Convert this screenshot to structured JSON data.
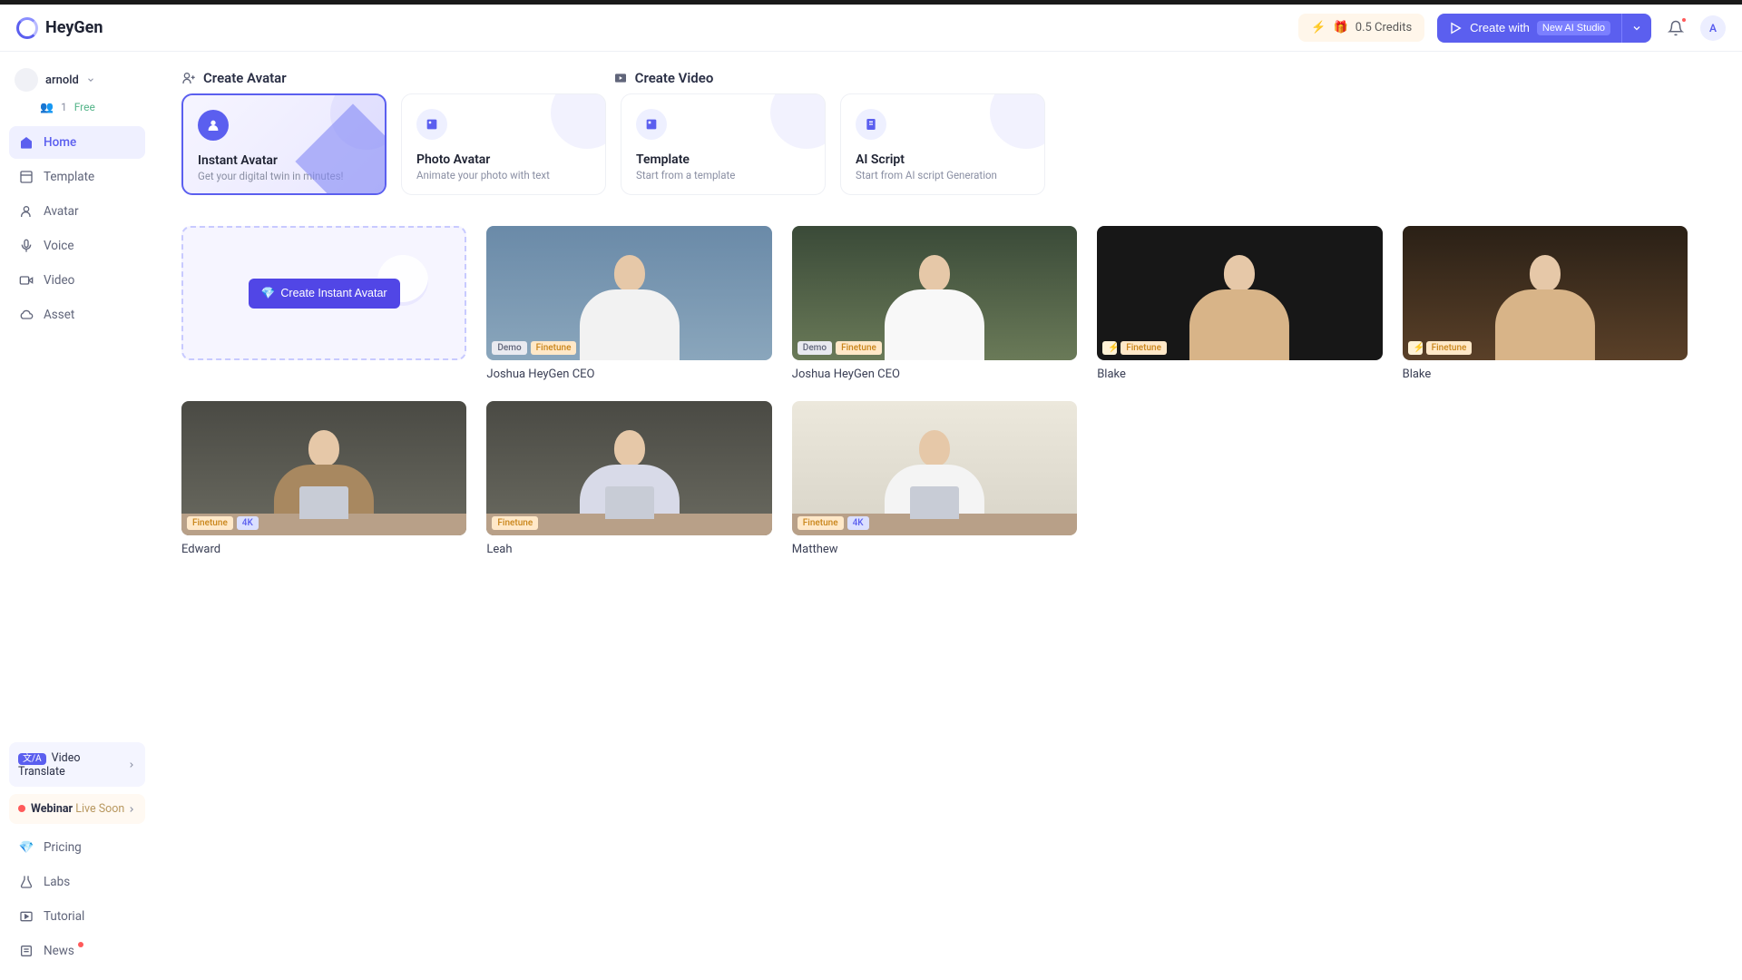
{
  "brand": "HeyGen",
  "header": {
    "credits": "0.5 Credits",
    "create_with": "Create with",
    "create_with_tag": "New AI Studio",
    "avatar_initial": "A"
  },
  "workspace": {
    "name": "arnold",
    "members": "1",
    "plan": "Free"
  },
  "nav": {
    "home": "Home",
    "template": "Template",
    "avatar": "Avatar",
    "voice": "Voice",
    "video": "Video",
    "asset": "Asset",
    "video_translate": "Video Translate",
    "webinar_label": "Webinar",
    "webinar_live": "Live Soon",
    "pricing": "Pricing",
    "labs": "Labs",
    "tutorial": "Tutorial",
    "news": "News"
  },
  "sections": {
    "create_avatar": "Create Avatar",
    "create_video": "Create Video"
  },
  "cards": {
    "instant": {
      "title": "Instant Avatar",
      "sub": "Get your digital twin in minutes!"
    },
    "photo": {
      "title": "Photo Avatar",
      "sub": "Animate your photo with text"
    },
    "template": {
      "title": "Template",
      "sub": "Start from a template"
    },
    "aiscript": {
      "title": "AI Script",
      "sub": "Start from AI script Generation"
    }
  },
  "create_tile_btn": "Create Instant Avatar",
  "badges": {
    "demo": "Demo",
    "finetune": "Finetune",
    "fourk": "4K"
  },
  "avatars": [
    {
      "name": "Joshua HeyGen CEO",
      "bg": "linear-gradient(180deg,#6a8aa8 0%,#8aa6bc 100%)",
      "body": "#f2f2f2",
      "tags": [
        "demo",
        "finetune"
      ]
    },
    {
      "name": "Joshua HeyGen CEO",
      "bg": "linear-gradient(180deg,#3a4a38 0%,#6a7a58 100%)",
      "body": "#f8f8f8",
      "tags": [
        "demo",
        "finetune"
      ]
    },
    {
      "name": "Blake",
      "bg": "#171717",
      "body": "#d8b488",
      "tags": [
        "lightning",
        "finetune"
      ]
    },
    {
      "name": "Blake",
      "bg": "linear-gradient(180deg,#2a2016 0%,#5a4028 100%)",
      "body": "#d8b488",
      "tags": [
        "lightning",
        "finetune"
      ]
    },
    {
      "name": "Edward",
      "bg": "linear-gradient(180deg,#4a4a44 0%,#6a6a60 100%)",
      "body": "#a88860",
      "tags": [
        "finetune",
        "fourk"
      ],
      "desk": true
    },
    {
      "name": "Leah",
      "bg": "linear-gradient(180deg,#4a4a44 0%,#6a6a60 100%)",
      "body": "#d8dae8",
      "tags": [
        "finetune"
      ],
      "desk": true
    },
    {
      "name": "Matthew",
      "bg": "linear-gradient(180deg,#ece8dc 0%,#d8d4c8 100%)",
      "body": "#f4f4f4",
      "tags": [
        "finetune",
        "fourk"
      ],
      "desk": true
    }
  ]
}
